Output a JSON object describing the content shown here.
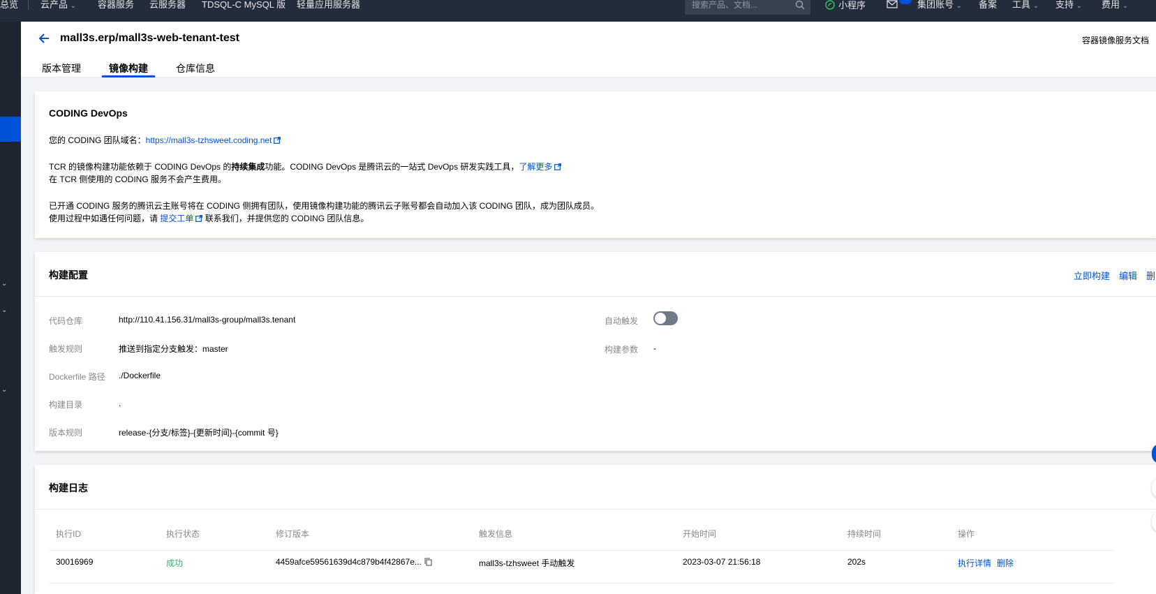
{
  "topnav": {
    "overview": "总览",
    "products": "云产品",
    "links": [
      "容器服务",
      "云服务器",
      "TDSQL-C MySQL 版",
      "轻量应用服务器"
    ],
    "search_placeholder": "搜索产品、文档...",
    "miniapp": "小程序",
    "account": "集团账号",
    "beian": "备案",
    "tools": "工具",
    "support": "支持",
    "billing": "费用"
  },
  "header": {
    "repo_title": "mall3s.erp/mall3s-web-tenant-test",
    "doc_link": "容器镜像服务文档",
    "tabs": [
      "版本管理",
      "镜像构建",
      "仓库信息"
    ]
  },
  "coding": {
    "title": "CODING DevOps",
    "domain_label": "您的 CODING 团队域名：",
    "domain_url": "https://mall3s-tzhsweet.coding.net",
    "line1_a": "TCR 的镜像构建功能依赖于 CODING DevOps 的",
    "line1_bold": "持续集成",
    "line1_b": "功能。CODING DevOps 是腾讯云的一站式 DevOps 研发实践工具，",
    "learn_more": "了解更多",
    "line2": "在 TCR 侧使用的 CODING 服务不会产生费用。",
    "line3": "已开通 CODING 服务的腾讯云主账号将在 CODING 侧拥有团队，使用镜像构建功能的腾讯云子账号都会自动加入该 CODING 团队，成为团队成员。",
    "line4_a": "使用过程中如遇任何问题，请",
    "ticket": "提交工单",
    "line4_b": "联系我们，并提供您的 CODING 团队信息。"
  },
  "build_config": {
    "title": "构建配置",
    "actions": [
      "立即构建",
      "编辑",
      "删除"
    ],
    "fields": [
      {
        "label": "代码仓库",
        "value": "http://110.41.156.31/mall3s-group/mall3s.tenant"
      },
      {
        "label": "触发规则",
        "value": "推送到指定分支触发：master"
      },
      {
        "label": "Dockerfile 路径",
        "value": "./Dockerfile"
      },
      {
        "label": "构建目录",
        "value": "."
      },
      {
        "label": "版本规则",
        "value": "release-{分支/标签}-{更新时间}-{commit 号}"
      }
    ],
    "auto_trigger_label": "自动触发",
    "auto_trigger_on": false,
    "build_params_label": "构建参数",
    "build_params_value": "-"
  },
  "build_log": {
    "title": "构建日志",
    "columns": [
      "执行ID",
      "执行状态",
      "修订版本",
      "触发信息",
      "开始时间",
      "持续时间",
      "操作"
    ],
    "rows": [
      {
        "id": "30016969",
        "status": "成功",
        "revision": "4459afce59561639d4c879b4f42867e...",
        "trigger": "mall3s-tzhsweet 手动触发",
        "start": "2023-03-07 21:56:18",
        "duration": "202s",
        "detail": "执行详情",
        "delete": "删除"
      }
    ]
  },
  "colors": {
    "accent": "#0052d9",
    "nav_bg": "#232c3b",
    "success": "#34b36a"
  }
}
